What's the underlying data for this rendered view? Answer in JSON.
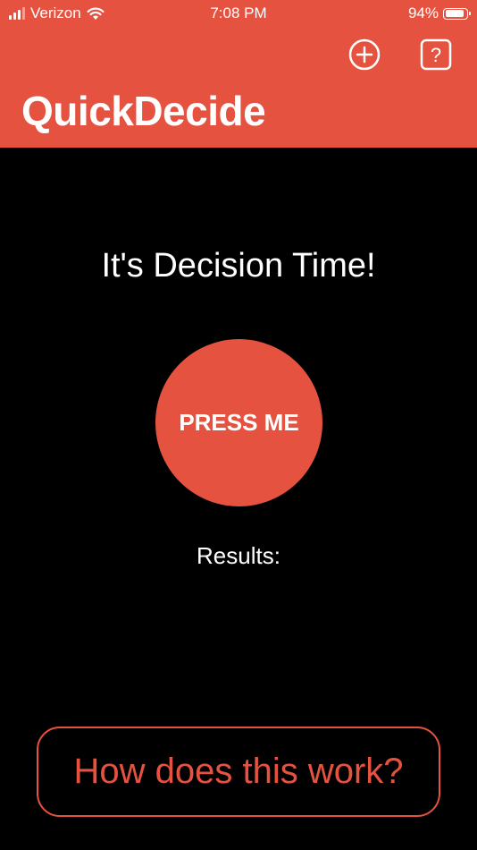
{
  "status_bar": {
    "carrier": "Verizon",
    "time": "7:08 PM",
    "battery_percent": "94%",
    "battery_level": 0.94,
    "signal_bars": 3,
    "icons": [
      "signal-icon",
      "wifi-icon",
      "battery-icon"
    ]
  },
  "header": {
    "title": "QuickDecide",
    "actions": [
      {
        "name": "add",
        "icon": "plus-circle-icon"
      },
      {
        "name": "help",
        "icon": "question-square-icon"
      }
    ]
  },
  "main": {
    "heading": "It's Decision Time!",
    "press_button_label": "PRESS ME",
    "results_label": "Results:",
    "results_value": "",
    "how_button_label": "How does this work?"
  },
  "colors": {
    "accent": "#E65240",
    "background": "#000000",
    "text": "#FFFFFF"
  }
}
